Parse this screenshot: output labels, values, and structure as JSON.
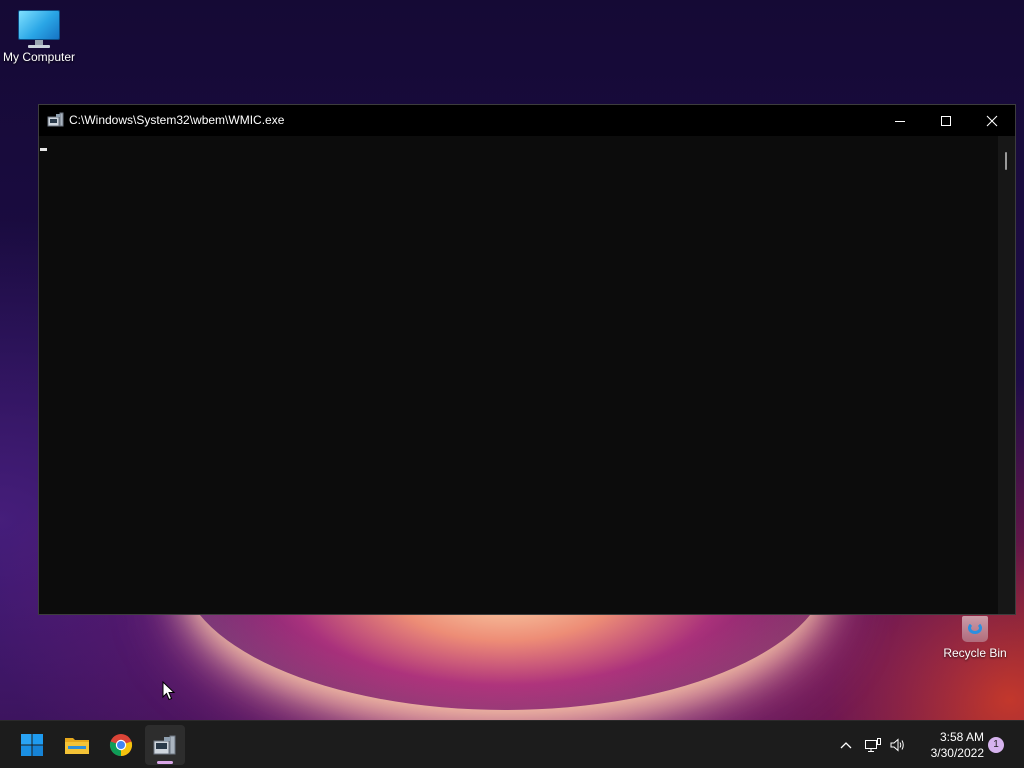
{
  "desktop": {
    "icons": [
      {
        "label": "My Computer",
        "icon": "monitor-icon"
      },
      {
        "label": "Recycle Bin",
        "icon": "recycle-bin-icon"
      }
    ]
  },
  "window": {
    "title": "C:\\Windows\\System32\\wbem\\WMIC.exe",
    "icon": "console-app-icon",
    "controls": {
      "minimize": "minimize-icon",
      "maximize": "maximize-icon",
      "close": "close-icon"
    },
    "background": "#0c0c0c"
  },
  "taskbar": {
    "apps": [
      {
        "name": "Start",
        "icon": "windows-start-icon"
      },
      {
        "name": "File Explorer",
        "icon": "folder-icon"
      },
      {
        "name": "Google Chrome",
        "icon": "chrome-icon"
      },
      {
        "name": "WMIC.exe",
        "icon": "console-app-icon",
        "active": true
      }
    ],
    "tray": {
      "icons": [
        "chevron-up-icon",
        "network-icon",
        "volume-icon"
      ],
      "time": "3:58 AM",
      "date": "3/30/2022",
      "notification_count": "1"
    }
  },
  "colors": {
    "taskbar_bg": "#1c1c1c",
    "accent_indicator": "#d9a7e8",
    "badge_bg": "#d6b3ee",
    "folder_yellow": "#f4c236",
    "start_blue": "#1e9bf0"
  }
}
